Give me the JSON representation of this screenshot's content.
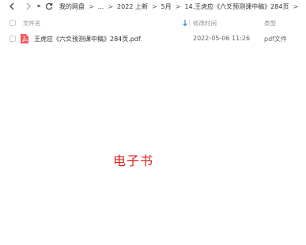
{
  "nav": {
    "back_icon": "chevron-left",
    "forward_icon": "chevron-right",
    "dropdown_icon": "caret-down",
    "refresh_icon": "refresh"
  },
  "breadcrumb": {
    "items": [
      "我的网盘",
      "...",
      "2022 上新",
      "5月",
      "14.王虎应《六爻预测课中稿》284页"
    ],
    "separator": ">"
  },
  "columns": {
    "name": "文件名",
    "modified": "修改时间",
    "type": "类型"
  },
  "files": [
    {
      "name": "王虎应《六爻预测课中稿》284页.pdf",
      "modified": "2022-05-06 11:26",
      "type": "pdf文件",
      "icon": "pdf-icon"
    }
  ],
  "overlay": {
    "label": "电子书",
    "color": "#e02020"
  },
  "colors": {
    "pdf_icon": "#f25a5a",
    "sort_arrow": "#3d7ff5"
  }
}
